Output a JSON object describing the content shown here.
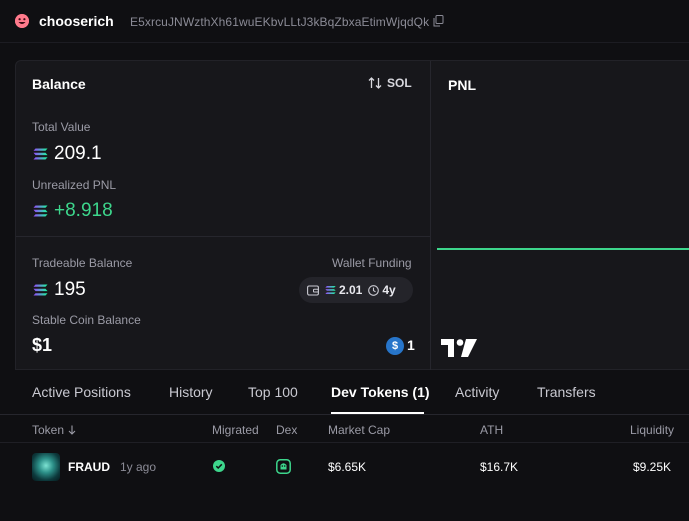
{
  "header": {
    "username": "chooserich",
    "address": "E5xrcuJNWzthXh61wuEKbvLLtJ3kBqZbxaEtimWjqdQk"
  },
  "balance": {
    "title": "Balance",
    "currency_toggle": "SOL",
    "total_value_label": "Total Value",
    "total_value": "209.1",
    "unrealized_pnl_label": "Unrealized PNL",
    "unrealized_pnl": "+8.918",
    "tradeable_balance_label": "Tradeable Balance",
    "tradeable_balance": "195",
    "wallet_funding_label": "Wallet Funding",
    "wallet_funding_amount": "2.01",
    "wallet_funding_age": "4y",
    "stable_coin_label": "Stable Coin Balance",
    "stable_coin_value": "$1",
    "stable_coin_count": "1"
  },
  "pnl": {
    "title": "PNL"
  },
  "tabs": [
    {
      "label": "Active Positions",
      "active": false
    },
    {
      "label": "History",
      "active": false
    },
    {
      "label": "Top 100",
      "active": false
    },
    {
      "label": "Dev Tokens (1)",
      "active": true
    },
    {
      "label": "Activity",
      "active": false
    },
    {
      "label": "Transfers",
      "active": false
    }
  ],
  "table": {
    "headers": [
      "Token",
      "Migrated",
      "Dex",
      "Market Cap",
      "ATH",
      "Liquidity"
    ],
    "rows": [
      {
        "token": "FRAUD",
        "age": "1y ago",
        "market_cap": "$6.65K",
        "ath": "$16.7K",
        "liquidity": "$9.25K"
      }
    ]
  },
  "colors": {
    "accent_green": "#3dd68c",
    "usdc_blue": "#2775ca"
  },
  "icons": [
    "grinning-emoji-icon",
    "copy-icon",
    "swap-arrows-icon",
    "solana-icon",
    "wallet-icon",
    "clock-icon",
    "usdc-icon",
    "tradingview-logo",
    "sort-down-icon",
    "check-circle-icon",
    "dex-icon"
  ]
}
